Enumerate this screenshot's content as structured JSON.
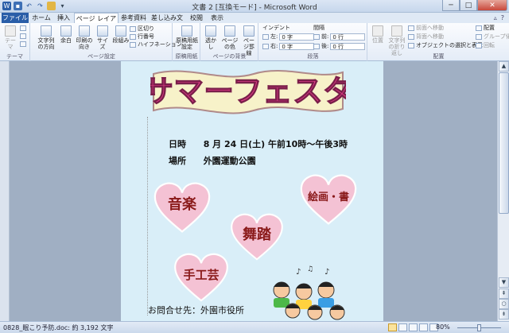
{
  "window": {
    "title": "文書 2 [互換モード] - Microsoft Word",
    "minimize_glyph": "─",
    "maximize_glyph": "□",
    "close_glyph": "✕"
  },
  "quick_access": {
    "icons": [
      "word-icon",
      "save-icon",
      "undo-icon",
      "redo-icon",
      "open-icon",
      "customize-icon"
    ]
  },
  "tabs": [
    {
      "label": "ファイル"
    },
    {
      "label": "ホーム"
    },
    {
      "label": "挿入"
    },
    {
      "label": "ページ レイアウト"
    },
    {
      "label": "参考資料"
    },
    {
      "label": "差し込み文書"
    },
    {
      "label": "校閲"
    },
    {
      "label": "表示"
    }
  ],
  "tab_help": {
    "minimize_ribbon_glyph": "▵",
    "help_glyph": "?"
  },
  "ribbon": {
    "theme": {
      "label": "テーマ",
      "group": "テーマ"
    },
    "page_setup": {
      "group": "ページ設定",
      "text_direction": "文字列の方向",
      "margins": "余白",
      "orientation": "印刷の向き",
      "size": "サイズ",
      "columns": "段組み",
      "breaks": "区切り",
      "line_numbers": "行番号",
      "hyphenation": "ハイフネーション"
    },
    "manuscript": {
      "group": "原稿用紙",
      "label": "原稿用紙設定"
    },
    "page_background": {
      "group": "ページの背景",
      "watermark": "透かし",
      "page_color": "ページの色",
      "page_borders": "ページ罫線"
    },
    "paragraph": {
      "group": "段落",
      "indent_label": "インデント",
      "spacing_label": "間隔",
      "left_label": "左:",
      "left_value": "0 字",
      "right_label": "右:",
      "right_value": "0 字",
      "before_label": "前:",
      "before_value": "0 行",
      "after_label": "後:",
      "after_value": "0 行"
    },
    "arrange": {
      "group": "配置",
      "position": "位置",
      "wrap_text": "文字列の折り返し",
      "bring_forward": "前面へ移動",
      "send_backward": "背面へ移動",
      "selection_pane": "オブジェクトの選択と表示",
      "align": "配置",
      "group_btn": "グループ化",
      "rotate": "回転"
    }
  },
  "document": {
    "banner_text": "サマーフェスタ",
    "date_label": "日時",
    "date_value": "8 月 24 日(土)  午前10時～午後3時",
    "place_label": "場所",
    "place_value": "外園運動公園",
    "hearts": [
      {
        "text": "音楽",
        "color": "#f4c2d4"
      },
      {
        "text": "絵画・書",
        "color": "#f4c2d4"
      },
      {
        "text": "舞踏",
        "color": "#f4c2d4"
      },
      {
        "text": "手工芸",
        "color": "#f4c2d4"
      }
    ],
    "contact": "お問合せ先：外園市役所"
  },
  "status": {
    "doc_info": "0828_眠こり予防.doc: 約 3,192 文字",
    "zoom": "80%",
    "zoom_level": 0.5
  },
  "colors": {
    "banner_fill": "#f7f2c9",
    "banner_text": "#e43c8a",
    "page_bg": "#d9eef8",
    "heart_fill": "#f4c2d4",
    "heart_text": "#8a1a1a"
  }
}
